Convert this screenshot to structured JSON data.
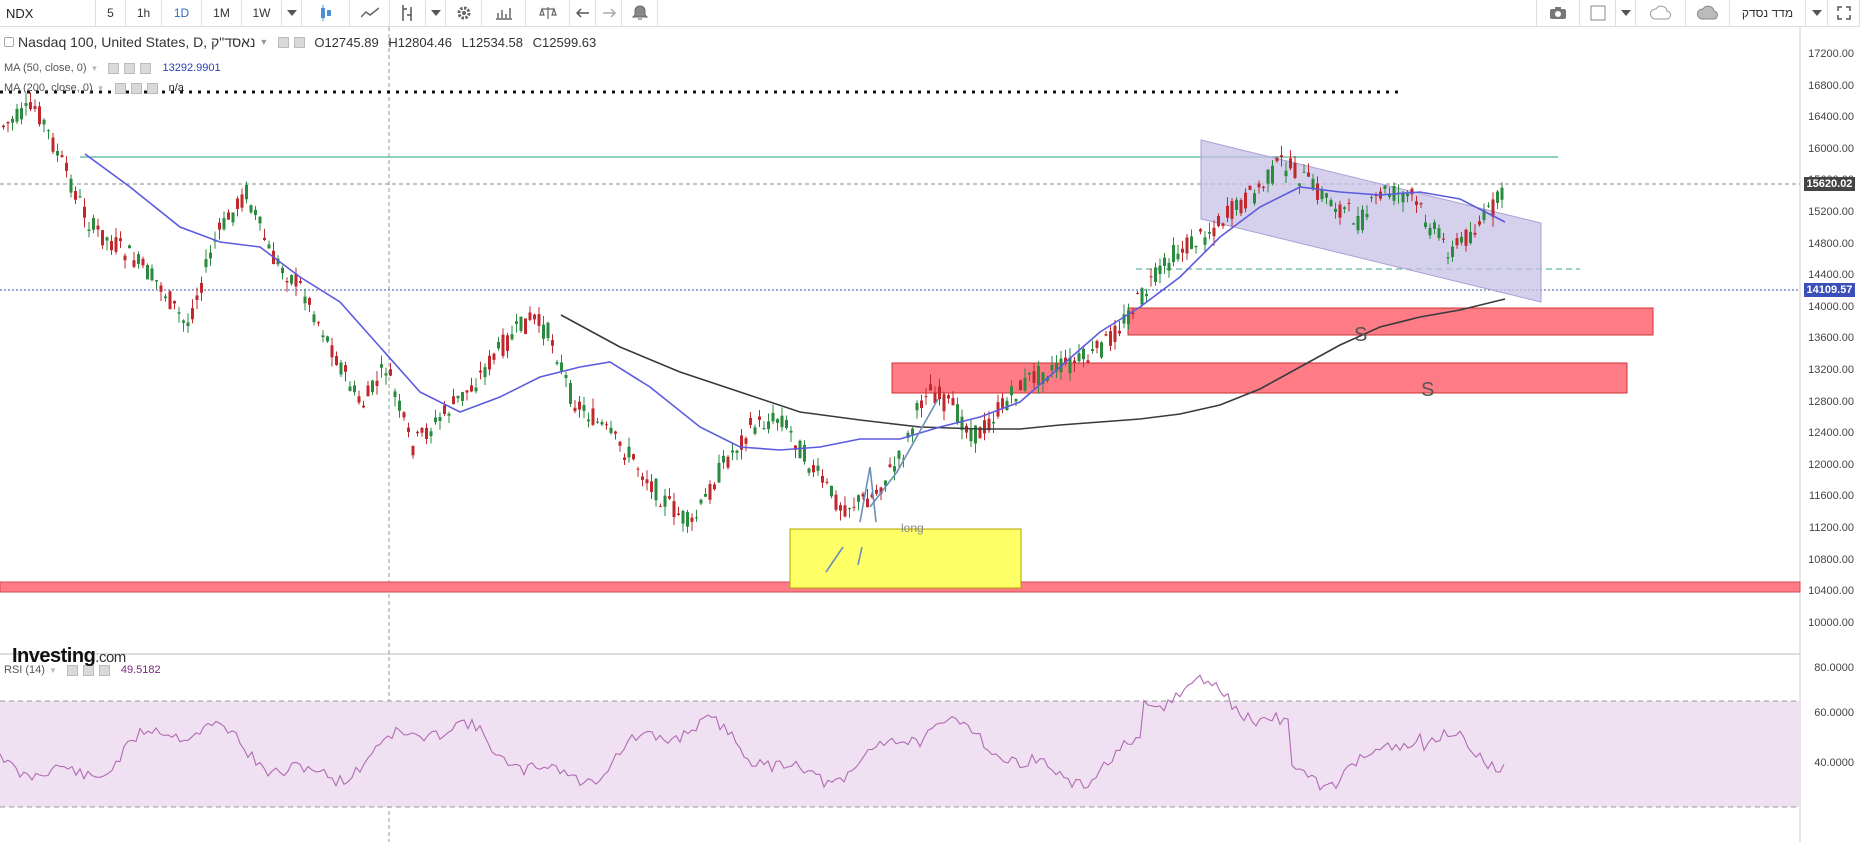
{
  "toolbar": {
    "symbol": "NDX",
    "intervals": [
      "5",
      "1h",
      "1D",
      "1M",
      "1W"
    ],
    "active_interval": "1D",
    "right_label": "מדד נסדק"
  },
  "legend": {
    "title": "Nasdaq 100, United States, D, נאסד\"ק",
    "open_label": "O",
    "open": "12745.89",
    "high_label": "H",
    "high": "12804.46",
    "low_label": "L",
    "low": "12534.58",
    "close_label": "C",
    "close": "12599.63",
    "ma50_label": "MA (50, close, 0)",
    "ma50_value": "13292.9901",
    "ma200_label": "MA (200, close, 0)",
    "ma200_value": "n/a",
    "rsi_label": "RSI (14)",
    "rsi_value": "49.5182"
  },
  "price_axis": [
    "17200.00",
    "16800.00",
    "16400.00",
    "16000.00",
    "15600.00",
    "15200.00",
    "14800.00",
    "14400.00",
    "14000.00",
    "13600.00",
    "13200.00",
    "12800.00",
    "12400.00",
    "12000.00",
    "11600.00",
    "11200.00",
    "10800.00",
    "10400.00",
    "10000.00"
  ],
  "rsi_axis": [
    "80.0000",
    "60.0000",
    "40.0000"
  ],
  "badges": {
    "resistance": "15620.02",
    "current": "14109.57"
  },
  "annotations": {
    "supply_label_1": "S",
    "supply_label_2": "S",
    "long_label": "long"
  },
  "logo": {
    "brand": "Investing",
    "suffix": ".com"
  },
  "colors": {
    "bull": "#2a8a3e",
    "bear": "#c0282d",
    "ma50": "#5b5be0",
    "ma200": "#3a3a3a",
    "rsi": "#b06ab3",
    "supply_zone": "#ff7c86",
    "demand_zone": "#ffff66",
    "channel": "#c7c0e4"
  }
}
